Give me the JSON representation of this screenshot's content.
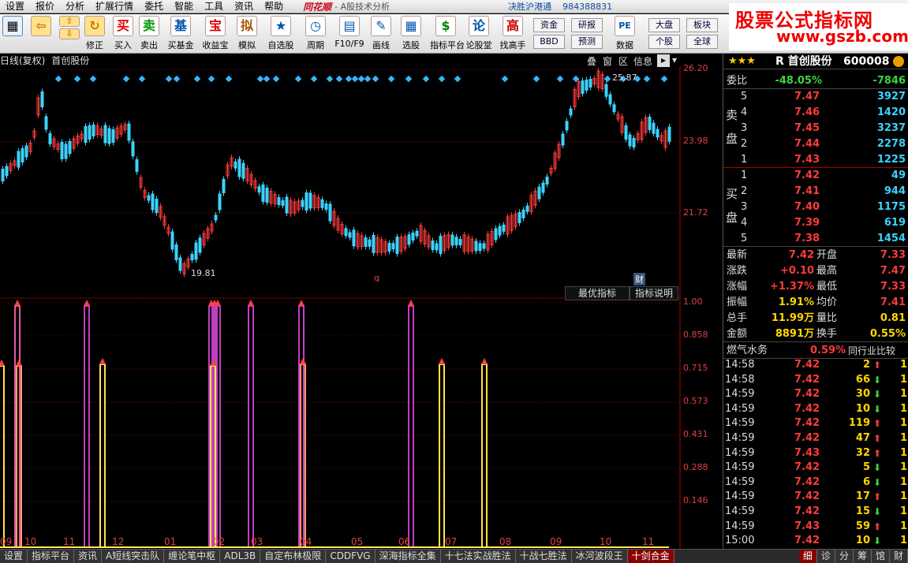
{
  "menu": {
    "items": [
      "设置",
      "报价",
      "分析",
      "扩展行情",
      "委托",
      "智能",
      "工具",
      "资讯",
      "帮助"
    ],
    "brand": "同花顺",
    "app": "- A股技术分析",
    "sub": "决胜沪港通",
    "acct": "984388831"
  },
  "toolbar": {
    "buttons": [
      {
        "label": "买入",
        "icon": "买"
      },
      {
        "label": "卖出",
        "icon": "卖"
      },
      {
        "label": "买基金",
        "icon": "基"
      },
      {
        "label": "收益宝",
        "icon": "宝"
      },
      {
        "label": "模拟",
        "icon": "拟"
      },
      {
        "label": "自选股",
        "icon": "★"
      },
      {
        "label": "周期",
        "icon": "◷"
      },
      {
        "label": "F10/F9",
        "icon": "▤"
      },
      {
        "label": "画线",
        "icon": "✎"
      },
      {
        "label": "选股",
        "icon": "▦"
      },
      {
        "label": "指标平台",
        "icon": "$"
      },
      {
        "label": "论股堂",
        "icon": "论"
      },
      {
        "label": "找高手",
        "icon": "高"
      }
    ],
    "nav_labels": [
      "修正",
      "数据"
    ],
    "small": [
      "资金",
      "研报",
      "大盘",
      "板块",
      "BBD",
      "预测",
      "个股",
      "全球",
      "PE"
    ]
  },
  "watermark": {
    "line1": "股票公式指标网",
    "line2": "www.gszb.com"
  },
  "chart": {
    "mode": "日线(复权)",
    "stock": "首创股份",
    "header_buttons": [
      "叠",
      "窗",
      "区",
      "信息"
    ],
    "price_axis": [
      "26.20",
      "23.98",
      "21.72"
    ],
    "high_label": "25.87",
    "low_label": "19.81",
    "indicator_axis": [
      "1.00",
      "0.858",
      "0.715",
      "0.573",
      "0.431",
      "0.288",
      "0.146"
    ],
    "best_indicator": "最优指标",
    "indicator_desc": "指标说明",
    "marker_q": "q",
    "marker_cai": "财",
    "x_labels": [
      "09",
      "10",
      "11",
      "12",
      "01",
      "02",
      "03",
      "04",
      "05",
      "06",
      "07",
      "08",
      "09",
      "10",
      "11"
    ],
    "indicator_arrows": [
      2,
      20,
      110,
      130,
      268,
      271,
      274,
      277,
      318,
      381,
      384,
      521,
      560,
      614
    ]
  },
  "quote": {
    "name": "R 首创股份",
    "code": "600008",
    "stars": "★★★",
    "weibi_label": "委比",
    "weibi": "-48.05%",
    "weicha": "-7846",
    "sell_label": "卖盘",
    "buy_label": "买盘",
    "sell": [
      {
        "lvl": "5",
        "price": "7.47",
        "vol": "3927"
      },
      {
        "lvl": "4",
        "price": "7.46",
        "vol": "1420"
      },
      {
        "lvl": "3",
        "price": "7.45",
        "vol": "3237"
      },
      {
        "lvl": "2",
        "price": "7.44",
        "vol": "2278"
      },
      {
        "lvl": "1",
        "price": "7.43",
        "vol": "1225"
      }
    ],
    "buy": [
      {
        "lvl": "1",
        "price": "7.42",
        "vol": "49"
      },
      {
        "lvl": "2",
        "price": "7.41",
        "vol": "944"
      },
      {
        "lvl": "3",
        "price": "7.40",
        "vol": "1175"
      },
      {
        "lvl": "4",
        "price": "7.39",
        "vol": "619"
      },
      {
        "lvl": "5",
        "price": "7.38",
        "vol": "1454"
      }
    ],
    "stats": [
      {
        "l1": "最新",
        "v1": "7.42",
        "l2": "开盘",
        "v2": "7.33"
      },
      {
        "l1": "涨跌",
        "v1": "+0.10",
        "l2": "最高",
        "v2": "7.47"
      },
      {
        "l1": "涨幅",
        "v1": "+1.37%",
        "l2": "最低",
        "v2": "7.33"
      },
      {
        "l1": "振幅",
        "v1": "1.91%",
        "l2": "均价",
        "v2": "7.41"
      },
      {
        "l1": "总手",
        "v1": "11.99万",
        "l2": "量比",
        "v2": "0.81"
      },
      {
        "l1": "金额",
        "v1": "8891万",
        "l2": "换手",
        "v2": "0.55%"
      }
    ],
    "sector": "燃气水务",
    "sector_pct": "0.59%",
    "sector_cmp": "同行业比较",
    "ticks": [
      {
        "t": "14:58",
        "p": "7.42",
        "v": "2",
        "d": "up",
        "n": "1"
      },
      {
        "t": "14:58",
        "p": "7.42",
        "v": "66",
        "d": "down",
        "n": "1"
      },
      {
        "t": "14:59",
        "p": "7.42",
        "v": "30",
        "d": "down",
        "n": "1"
      },
      {
        "t": "14:59",
        "p": "7.42",
        "v": "10",
        "d": "down",
        "n": "1"
      },
      {
        "t": "14:59",
        "p": "7.42",
        "v": "119",
        "d": "up",
        "n": "1"
      },
      {
        "t": "14:59",
        "p": "7.42",
        "v": "47",
        "d": "up",
        "n": "1"
      },
      {
        "t": "14:59",
        "p": "7.43",
        "v": "32",
        "d": "up",
        "n": "1"
      },
      {
        "t": "14:59",
        "p": "7.42",
        "v": "5",
        "d": "down",
        "n": "1"
      },
      {
        "t": "14:59",
        "p": "7.42",
        "v": "6",
        "d": "down",
        "n": "1"
      },
      {
        "t": "14:59",
        "p": "7.42",
        "v": "17",
        "d": "up",
        "n": "1"
      },
      {
        "t": "14:59",
        "p": "7.42",
        "v": "15",
        "d": "down",
        "n": "1"
      },
      {
        "t": "14:59",
        "p": "7.43",
        "v": "59",
        "d": "up",
        "n": "1"
      },
      {
        "t": "15:00",
        "p": "7.42",
        "v": "10",
        "d": "down",
        "n": "1"
      }
    ]
  },
  "bottom_tabs": [
    "设置",
    "指标平台",
    "资讯",
    "A短线突击队",
    "缠论笔中枢",
    "ADL3B",
    "自定布林极限",
    "CDDFVG",
    "深海指标全集",
    "十七法实战胜法",
    "十战七胜法",
    "冰河波段王",
    "十剑合金"
  ],
  "right_tabs": [
    "细",
    "诊",
    "分",
    "筹",
    "馆",
    "财"
  ],
  "colors": {
    "up": "#ff3b3b",
    "down": "#3cd63c",
    "accent": "#3bd3ff",
    "candle_up": "#ff3b3b",
    "candle_down": "#3bd3ff"
  }
}
